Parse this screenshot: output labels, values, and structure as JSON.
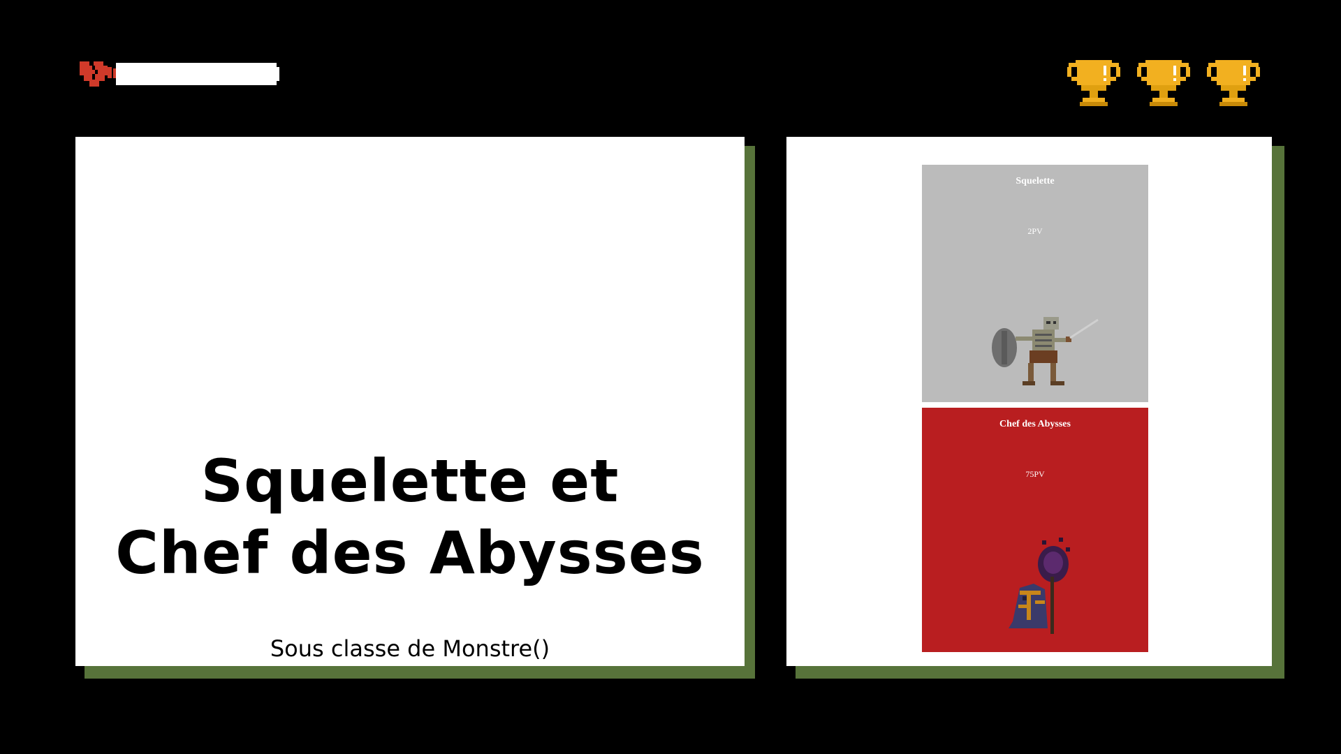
{
  "hud": {
    "health_icon": "broken-heart-icon",
    "health_fill": 0.0,
    "trophy_icons": [
      "trophy-icon",
      "trophy-icon",
      "trophy-icon"
    ],
    "trophy_count": 3
  },
  "colors": {
    "background": "#000000",
    "card": "#ffffff",
    "card_shadow": "#57733a",
    "skeleton_panel": "#bbbbbb",
    "boss_panel": "#b91e20",
    "heart": "#d03a2a",
    "trophy_gold": "#f2b020"
  },
  "left_card": {
    "title_line1": "Squelette et",
    "title_line2": "Chef des Abysses",
    "subtitle": "Sous classe de Monstre()"
  },
  "monsters": [
    {
      "name": "Squelette",
      "hp": "2PV",
      "sprite": "skeleton-warrior-sprite"
    },
    {
      "name": "Chef des Abysses",
      "hp": "75PV",
      "sprite": "abyss-chief-sprite"
    }
  ]
}
